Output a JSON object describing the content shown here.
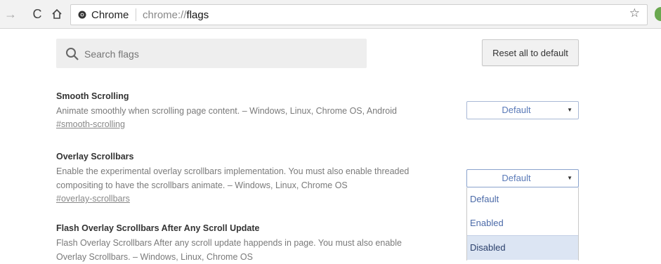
{
  "browser": {
    "chip_label": "Chrome",
    "url_scheme": "chrome://",
    "url_path": "flags"
  },
  "search": {
    "placeholder": "Search flags"
  },
  "reset_button": "Reset all to default",
  "flags": [
    {
      "title": "Smooth Scrolling",
      "description": "Animate smoothly when scrolling page content. – Windows, Linux, Chrome OS, Android",
      "link": "#smooth-scrolling",
      "value": "Default"
    },
    {
      "title": "Overlay Scrollbars",
      "description_line1": "Enable the experimental overlay scrollbars implementation. You must also enable threaded",
      "description_line2": "compositing to have the scrollbars animate. – Windows, Linux, Chrome OS",
      "link": "#overlay-scrollbars",
      "value": "Default",
      "options": [
        "Default",
        "Enabled",
        "Disabled"
      ],
      "highlighted_option": "Disabled"
    },
    {
      "title": "Flash Overlay Scrollbars After Any Scroll Update",
      "description_line1": "Flash Overlay Scrollbars After any scroll update happends in page. You must also enable",
      "description_line2": "Overlay Scrollbars. – Windows, Linux, Chrome OS"
    }
  ],
  "icons": {
    "back": "back-arrow-icon",
    "reload": "reload-icon",
    "home": "home-icon",
    "site_info": "chrome-logo-icon",
    "bookmark": "star-icon",
    "search": "search-icon"
  }
}
